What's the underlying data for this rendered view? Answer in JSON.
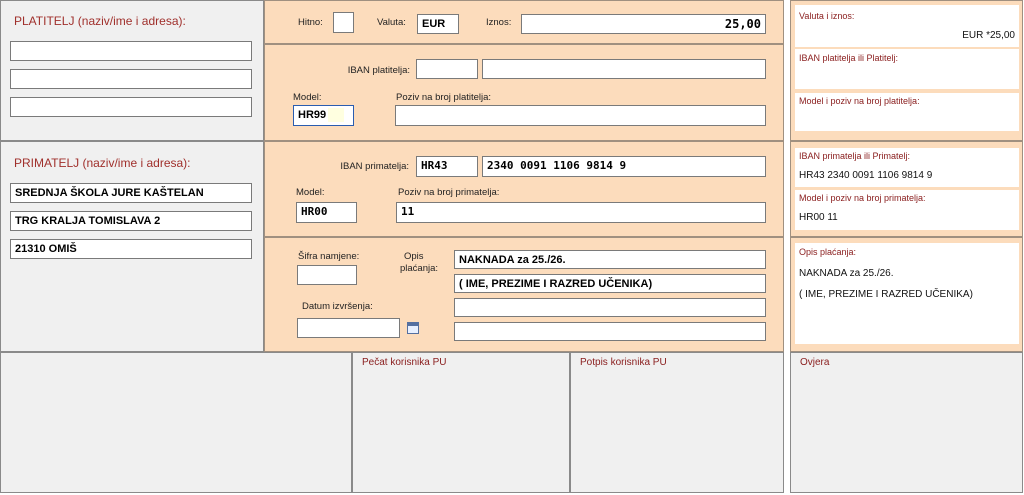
{
  "payer": {
    "title": "PLATITELJ (naziv/ime i adresa):",
    "lines": [
      "",
      "",
      ""
    ]
  },
  "top_row": {
    "urgent_label": "Hitno:",
    "currency_label": "Valuta:",
    "currency_value": "EUR",
    "amount_label": "Iznos:",
    "amount_value": "25,00"
  },
  "payer_account": {
    "iban_label": "IBAN platitelja:",
    "iban_prefix": "",
    "iban_number": "",
    "model_label": "Model:",
    "model_value": "HR99",
    "reference_label": "Poziv na broj platitelja:",
    "reference_value": ""
  },
  "recipient": {
    "title": "PRIMATELJ (naziv/ime i adresa):",
    "lines": [
      "SREDNJA ŠKOLA JURE KAŠTELAN",
      "TRG KRALJA TOMISLAVA 2",
      "21310 OMIŠ"
    ]
  },
  "recipient_account": {
    "iban_label": "IBAN primatelja:",
    "iban_prefix": "HR43",
    "iban_number": "2340 0091 1106 9814 9",
    "model_label": "Model:",
    "model_value": "HR00",
    "reference_label": "Poziv na broj primatelja:",
    "reference_value": "11"
  },
  "purpose": {
    "code_label": "Šifra namjene:",
    "code_value": "",
    "description_label_1": "Opis",
    "description_label_2": "plaćanja:",
    "description_lines": [
      "NAKNADA za 25./26.",
      "( IME, PREZIME I RAZRED UČENIKA)",
      "",
      ""
    ],
    "date_label": "Datum izvršenja:",
    "date_value": ""
  },
  "bottom": {
    "stamp_label": "Pečat korisnika PU",
    "signature_label": "Potpis korisnika PU",
    "verification_label": "Ovjera"
  },
  "receipt": {
    "amount_label": "Valuta i iznos:",
    "amount_value": "EUR  *25,00",
    "payer_label": "IBAN platitelja ili Platitelj:",
    "payer_value": "",
    "payer_ref_label": "Model i poziv na broj platitelja:",
    "payer_ref_value": "",
    "recipient_label": "IBAN primatelja ili Primatelj:",
    "recipient_value": "HR43 2340 0091 1106 9814 9",
    "recipient_ref_label": "Model i poziv na broj primatelja:",
    "recipient_ref_value": "HR00 11",
    "description_label": "Opis plaćanja:",
    "description_line_1": "NAKNADA za 25./26.",
    "description_line_2": "( IME, PREZIME I RAZRED UČENIKA)"
  }
}
